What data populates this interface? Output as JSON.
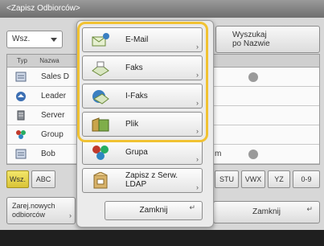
{
  "window": {
    "title": "<Zapisz Odbiorców>"
  },
  "filter": {
    "selected": "Wsz."
  },
  "search_button": {
    "line1": "Wyszukaj",
    "line2": "po Nazwie"
  },
  "list": {
    "headers": [
      "Typ",
      "Nazwa"
    ],
    "rows": [
      {
        "name": "Sales D",
        "icon": "book-icon"
      },
      {
        "name": "Leader",
        "icon": "fax-icon"
      },
      {
        "name": "Server",
        "icon": "server-icon"
      },
      {
        "name": "Group",
        "icon": "group-icon"
      },
      {
        "name": "Bob",
        "icon": "book-icon",
        "suffix": "m"
      }
    ]
  },
  "alphabet": [
    "Wsz.",
    "ABC",
    "STU",
    "VWX",
    "YZ",
    "0-9"
  ],
  "footer": {
    "register_line1": "Zarej.nowych",
    "register_line2": "odbiorców",
    "close": "Zamknij"
  },
  "popup": {
    "items": [
      {
        "label": "E-Mail",
        "icon": "email-icon"
      },
      {
        "label": "Faks",
        "icon": "fax-icon"
      },
      {
        "label": "I-Faks",
        "icon": "ifax-icon"
      },
      {
        "label": "Plik",
        "icon": "file-icon"
      },
      {
        "label": "Grupa",
        "icon": "group-icon"
      },
      {
        "label_line1": "Zapisz z Serw.",
        "label_line2": "LDAP",
        "icon": "ldap-server-icon"
      }
    ],
    "close": "Zamknij"
  },
  "colors": {
    "highlight": "#f1c232",
    "active_key": "#e3d04c",
    "title_bar": "#7a7a7a"
  }
}
